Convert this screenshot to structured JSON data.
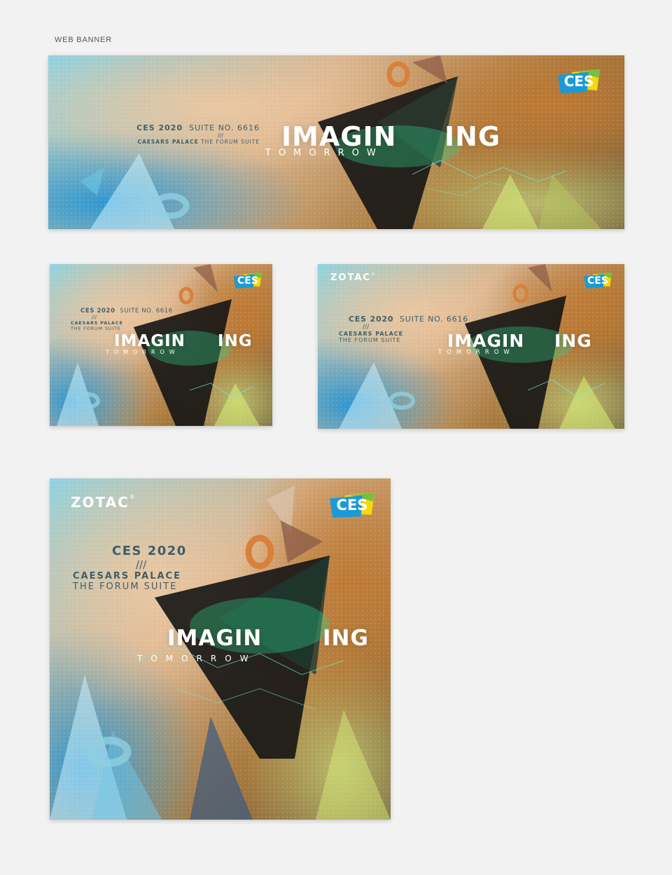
{
  "section_label": "WEB BANNER",
  "brand": {
    "ces_logo": "CES",
    "zotac_logo": "ZOTAC",
    "zotac_mark": "®"
  },
  "event": {
    "ces_year": "CES 2020",
    "suite": "SUITE NO. 6616",
    "divider": "///",
    "venue": "CAESARS PALACE",
    "suite_name": "THE FORUM SUITE"
  },
  "headline": {
    "left": "IMAGIN",
    "right": "ING",
    "sub": "TOMORROW"
  },
  "colors": {
    "page_bg": "#f2f2f2",
    "ces_blue": "#1a9bd7",
    "ces_yellow": "#f5d90a",
    "ces_green": "#74c043",
    "info_text": "#3e5e6a"
  }
}
